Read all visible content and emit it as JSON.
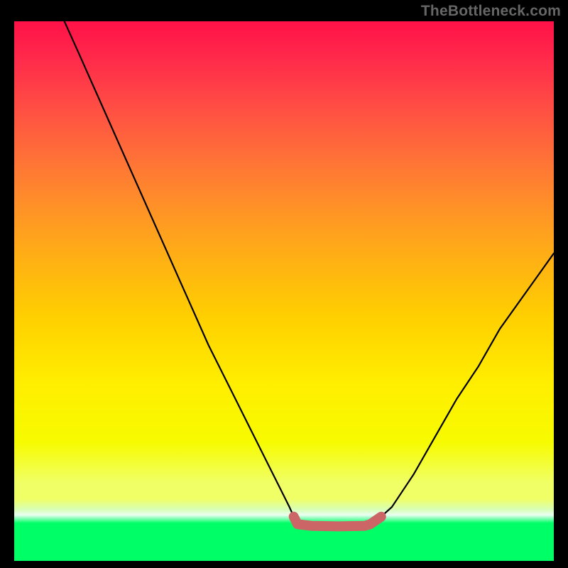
{
  "watermark": "TheBottleneck.com",
  "chart_data": {
    "type": "line",
    "title": "",
    "xlabel": "",
    "ylabel": "",
    "xlim": [
      0,
      100
    ],
    "ylim": [
      0,
      100
    ],
    "grid": false,
    "legend": false,
    "series": [
      {
        "name": "bottleneck-curve",
        "color": "#000000",
        "x_percent": [
          9.3,
          12,
          16,
          20,
          24,
          28,
          32,
          36,
          40,
          44,
          48,
          50,
          51,
          51.8,
          52.5,
          55,
          60,
          65,
          66,
          68,
          70,
          72,
          74,
          78,
          82,
          86,
          90,
          95,
          100
        ],
        "y_percent": [
          0,
          6,
          15,
          24,
          33,
          42,
          51,
          60,
          68,
          76,
          84,
          88,
          90,
          91.8,
          93.2,
          93.5,
          93.6,
          93.5,
          93.2,
          91.8,
          90,
          87,
          84,
          77,
          70,
          64,
          57,
          50,
          43
        ]
      },
      {
        "name": "optimal-band",
        "color": "#cc6666",
        "x_percent": [
          51.8,
          52.5,
          55,
          60,
          65,
          66,
          68
        ],
        "y_percent": [
          91.8,
          93.2,
          93.5,
          93.6,
          93.5,
          93.2,
          91.8
        ]
      }
    ],
    "gradient_stops": [
      {
        "pos": 0.0,
        "color": "#ff1148"
      },
      {
        "pos": 0.07,
        "color": "#ff2a4a"
      },
      {
        "pos": 0.15,
        "color": "#ff4a45"
      },
      {
        "pos": 0.25,
        "color": "#ff7038"
      },
      {
        "pos": 0.34,
        "color": "#ff9028"
      },
      {
        "pos": 0.44,
        "color": "#ffb014"
      },
      {
        "pos": 0.55,
        "color": "#ffd000"
      },
      {
        "pos": 0.67,
        "color": "#ffee00"
      },
      {
        "pos": 0.78,
        "color": "#f7fb00"
      },
      {
        "pos": 0.855,
        "color": "#f0ff66"
      },
      {
        "pos": 0.885,
        "color": "#f0ff66"
      },
      {
        "pos": 0.905,
        "color": "#d8ffb8"
      },
      {
        "pos": 0.915,
        "color": "#eafff2"
      },
      {
        "pos": 0.93,
        "color": "#00ff66"
      },
      {
        "pos": 1.0,
        "color": "#00ff66"
      }
    ]
  }
}
